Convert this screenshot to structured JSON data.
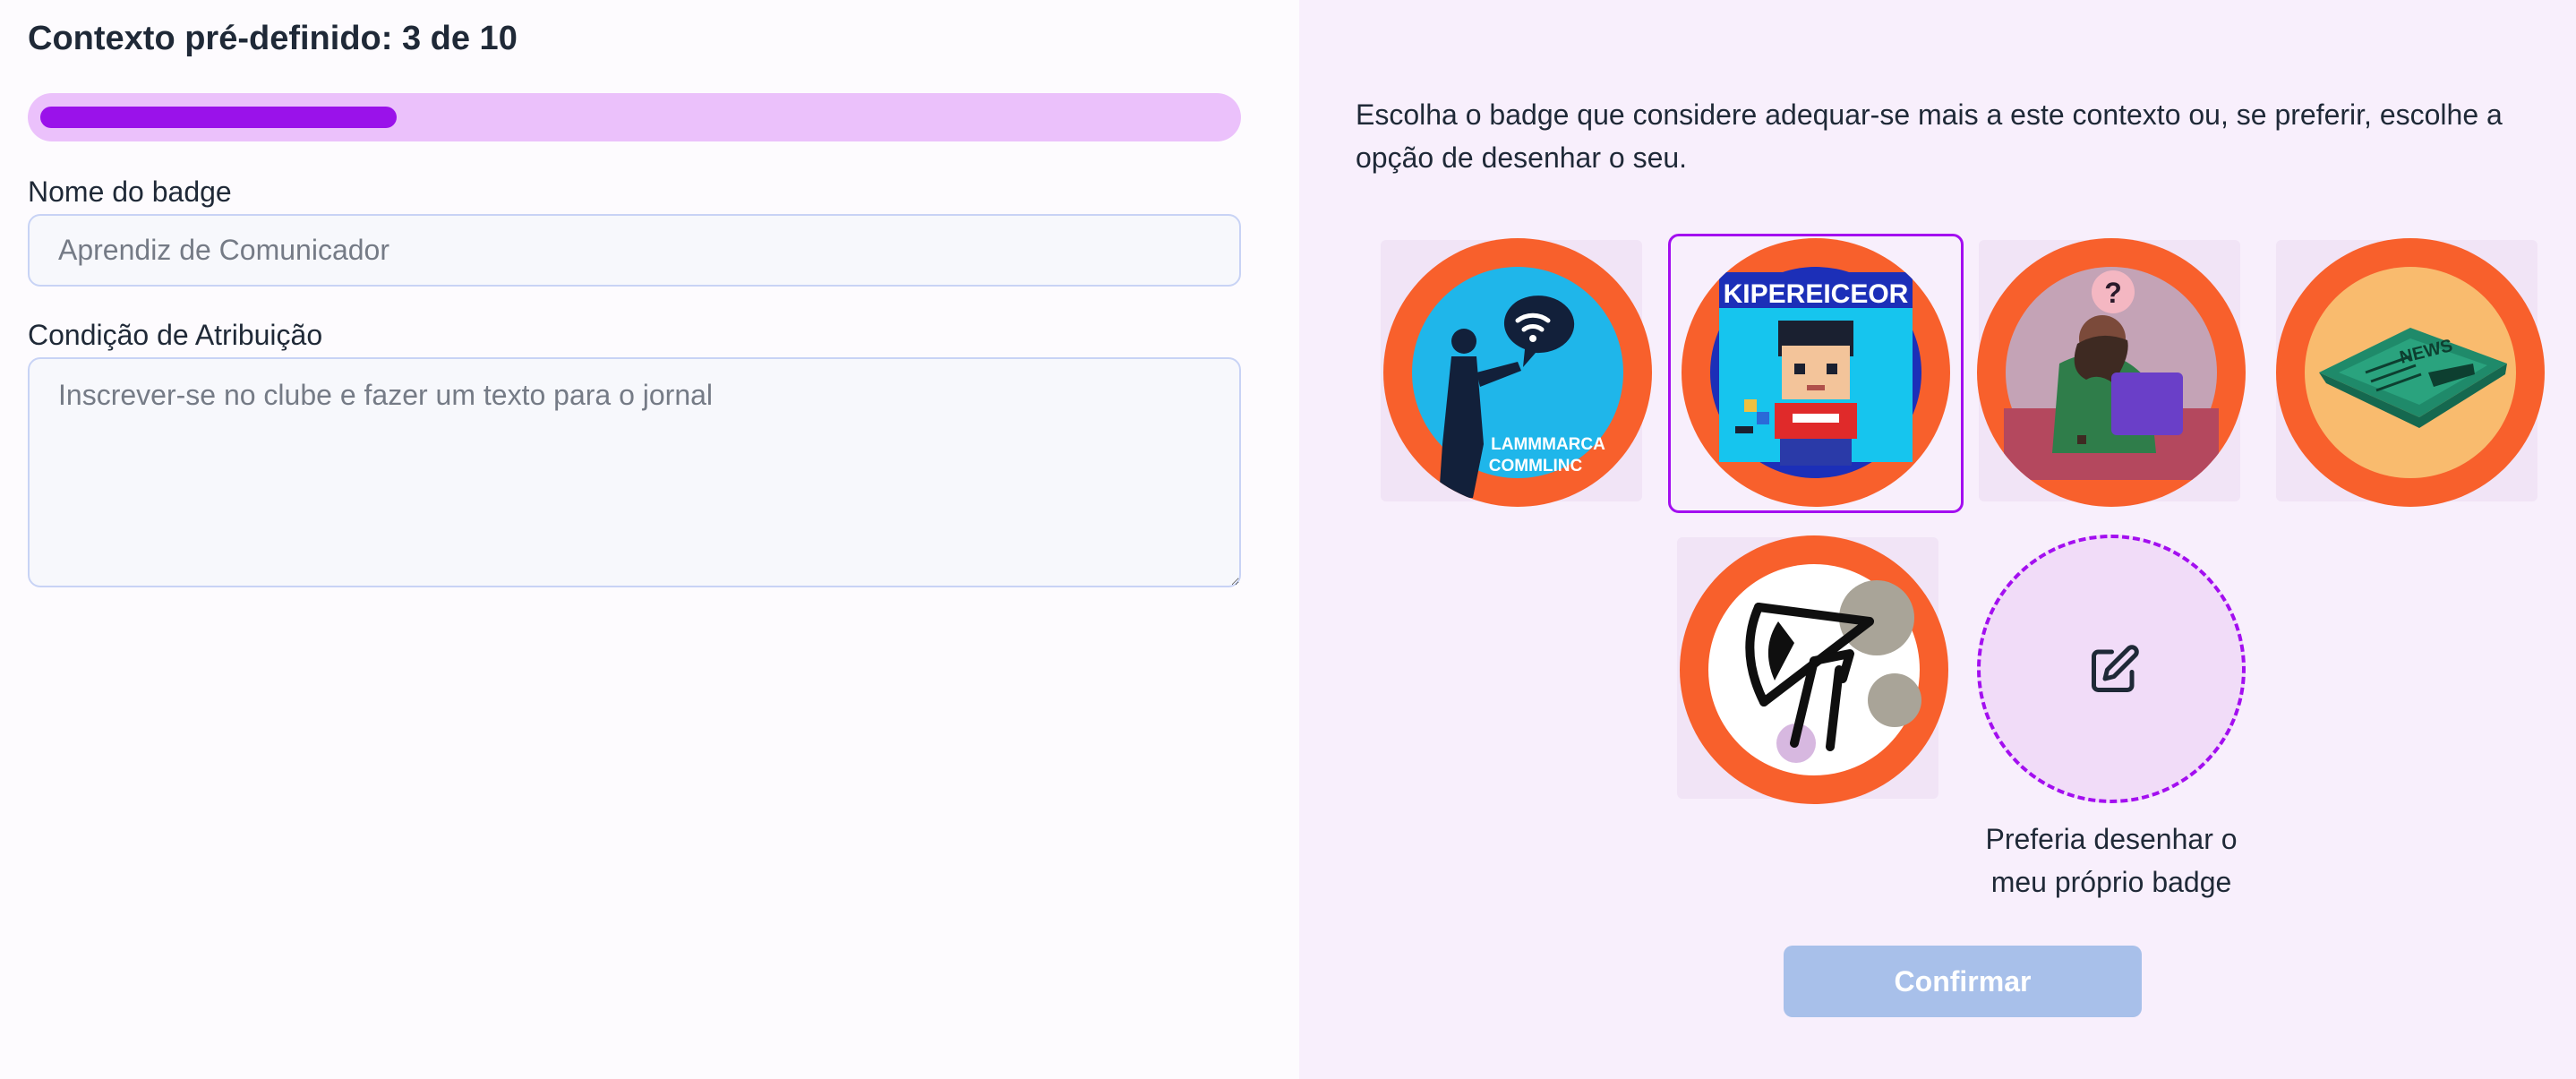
{
  "header": {
    "title": "Contexto pré-definido: 3 de 10",
    "progress_fraction": 0.3
  },
  "form": {
    "name_label": "Nome do badge",
    "name_placeholder": "Aprendiz de Comunicador",
    "condition_label": "Condição de Atribuição",
    "condition_placeholder": "Inscrever-se no clube e fazer um texto para o jornal"
  },
  "chooser": {
    "instruction": "Escolha o badge que considere adequar-se mais a este contexto ou, se preferir, escolhe a opção de desenhar o seu.",
    "badges": [
      {
        "icon": "speaker-wifi-bubble-badge-icon",
        "text_line1": "LAMMMARCA",
        "text_line2": "COMMLINC",
        "selected": false
      },
      {
        "icon": "pixel-character-badge-icon",
        "text_line1": "KIPEREICEOR",
        "selected": true
      },
      {
        "icon": "question-person-laptop-badge-icon",
        "text_line1": "?",
        "selected": false
      },
      {
        "icon": "newspaper-badge-icon",
        "text_line1": "NEWS",
        "selected": false
      },
      {
        "icon": "megaphone-figure-badge-icon",
        "selected": false
      }
    ],
    "draw_option_label": "Preferia desenhar o meu próprio badge",
    "draw_icon": "edit-icon",
    "confirm_label": "Confirmar"
  },
  "colors": {
    "accent": "#9a12ea",
    "progress_track": "#ebc1fb",
    "badge_ring": "#f8602c",
    "confirm_disabled": "#a8c0ea",
    "right_panel_bg": "#f8effc"
  }
}
